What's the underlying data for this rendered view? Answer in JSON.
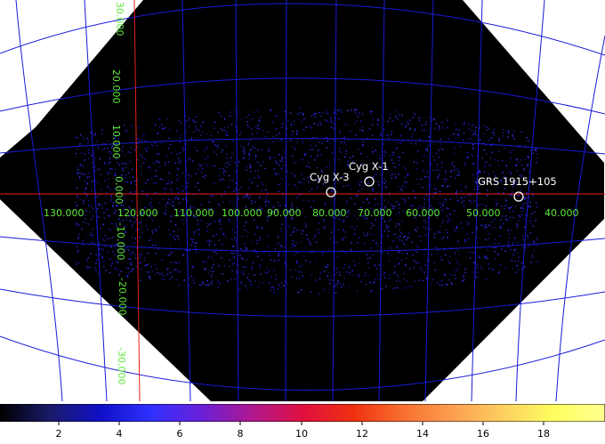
{
  "colors": {
    "background": "#ffffff",
    "image": "#000000",
    "grid": "#1a1ad8",
    "axis": "#e8201a",
    "grid_label": "#5eea3c",
    "source_label": "#ffffff",
    "counts": "#2a2ae0"
  },
  "grid": {
    "longitude_labels": [
      "130.000",
      "120.000",
      "110.000",
      "100.000",
      "90.000",
      "80.000",
      "70.000",
      "60.000",
      "50.000",
      "40.000"
    ],
    "latitude_labels": [
      "30.000",
      "20.000",
      "10.000",
      "0.000",
      "-10.000",
      "-20.000",
      "-30.000"
    ]
  },
  "sources": [
    {
      "name": "Cyg X-3"
    },
    {
      "name": "Cyg X-1"
    },
    {
      "name": "GRS 1915+105"
    }
  ],
  "colorbar": {
    "stops": [
      "#000000",
      "#1a1a6a",
      "#1010c8",
      "#3030ff",
      "#6a20d8",
      "#b01890",
      "#e01040",
      "#f03010",
      "#f87030",
      "#fba050",
      "#fcd060",
      "#ffff60",
      "#ffff90"
    ],
    "ticks": [
      "2",
      "4",
      "6",
      "8",
      "10",
      "12",
      "14",
      "16",
      "18"
    ]
  }
}
